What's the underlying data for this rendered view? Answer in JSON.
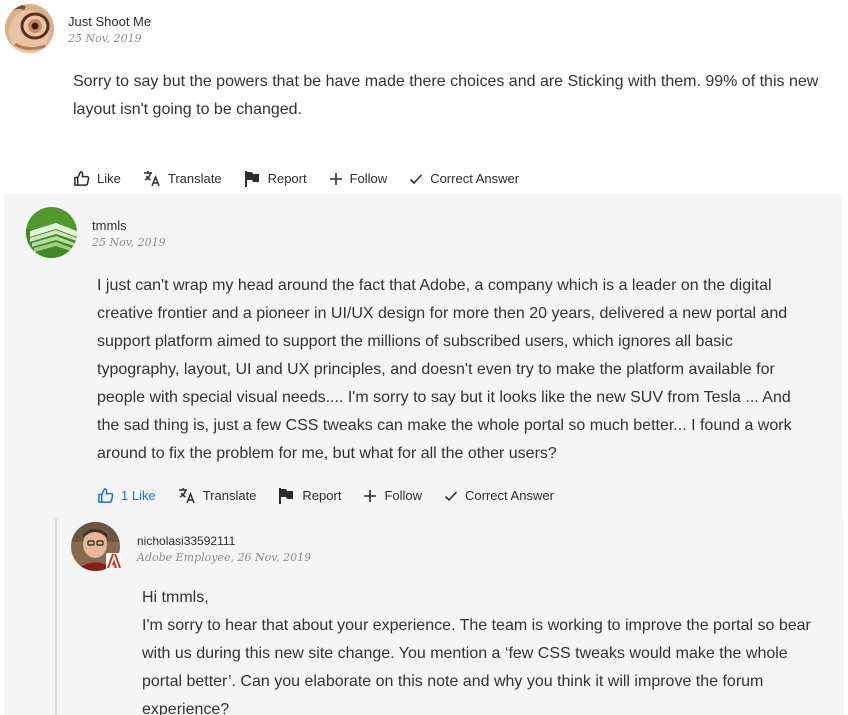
{
  "post1": {
    "author": "Just Shoot Me",
    "date": "25 Nov, 2019",
    "body": "Sorry to say but the powers that be have made there choices and are Sticking with them. 99% of this new layout isn't going to be changed.",
    "actions": {
      "like": "Like",
      "translate": "Translate",
      "report": "Report",
      "follow": "Follow",
      "correct_answer": "Correct Answer"
    }
  },
  "post2": {
    "author": "tmmls",
    "date": "25 Nov, 2019",
    "body": "I just can't wrap my head around the fact that Adobe, a company which is a leader on the digital creative frontier and a pioneer in UI/UX design for more then 20 years, delivered a new portal and support platform aimed to support the millions of subscribed users, which ignores all basic typography, layout, UI and UX principles, and doesn't even try to make the platform available for people with special visual needs.... I'm sorry to say but it looks like the new SUV from Tesla ... And the sad thing is, just a few CSS tweaks can make the whole portal so much better... I found a work around to fix the problem for me, but what for all the other users?",
    "actions": {
      "like": "1 Like",
      "translate": "Translate",
      "report": "Report",
      "follow": "Follow",
      "correct_answer": "Correct Answer"
    }
  },
  "reply": {
    "author": "nicholasi33592111",
    "meta": "Adobe Employee, 26 Nov, 2019",
    "greeting": "Hi tmmls,",
    "body": "I'm sorry to hear that about your experience. The team is working to improve the portal so bear with us during this new site change. You mention a ‘few CSS tweaks would make the whole portal better’. Can you elaborate on this note and why you think it will improve the forum experience?"
  },
  "colors": {
    "accent": "#1473e6",
    "thread_background": "#f5f5f5",
    "meta_text": "#8a8a8a"
  },
  "icons": [
    "thumbs-up-icon",
    "translate-icon",
    "flag-icon",
    "plus-icon",
    "checkmark-icon",
    "adobe-logo-icon"
  ]
}
